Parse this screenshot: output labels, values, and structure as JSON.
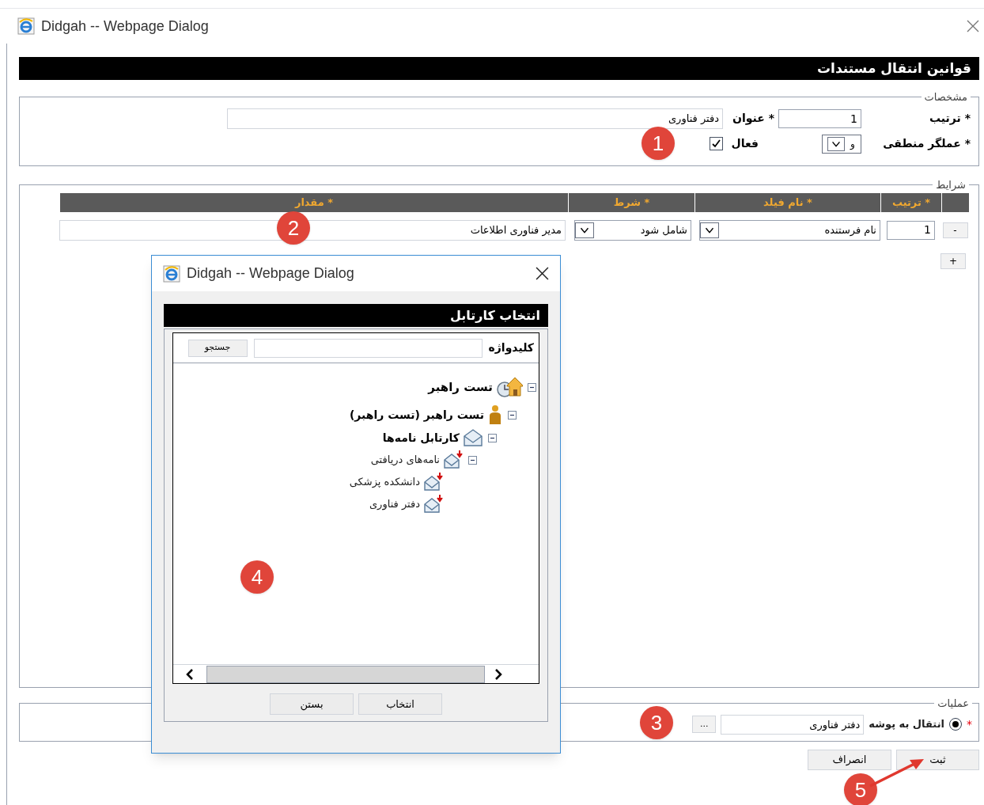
{
  "window": {
    "title": "Didgah -- Webpage Dialog"
  },
  "header": "قوانین انتقال مستندات",
  "details": {
    "legend": "مشخصات",
    "order_label": "* ترتیب",
    "order_value": "1",
    "title_label": "* عنوان",
    "title_value": "دفتر فناوری",
    "operator_label": "* عملگر منطقی",
    "operator_value": "و",
    "active_label": "فعال",
    "active_checked": true
  },
  "conditions": {
    "legend": "شرایط",
    "columns": [
      "* ترتیب",
      "* نام فیلد",
      "* شرط",
      "* مقدار"
    ],
    "rows": [
      {
        "remove": "-",
        "order": "1",
        "field": "نام فرستنده",
        "condition": "شامل شود",
        "value": "مدیر فناوری اطلاعات"
      }
    ],
    "add": "+"
  },
  "operations": {
    "legend": "عملیات",
    "required_mark": "*",
    "label": "انتقال به پوشه",
    "selected": true,
    "value": "دفتر فناوری",
    "browse": "..."
  },
  "buttons": [
    "ثبت",
    "انصراف"
  ],
  "picker": {
    "title": "Didgah -- Webpage Dialog",
    "header": "انتخاب کارتابل",
    "keyword_label": "کلیدواژه",
    "search_button": "جستجو",
    "tree": [
      {
        "label": "تست راهبر",
        "kind": "home",
        "expanded": true,
        "children": [
          {
            "label": "تست راهبر (تست راهبر)",
            "kind": "person",
            "expanded": true,
            "children": [
              {
                "label": "کارتابل نامه‌ها",
                "kind": "mailbox",
                "expanded": true,
                "children": [
                  {
                    "label": "نامه‌های دریافتی",
                    "kind": "inbox",
                    "expanded": true,
                    "children": [
                      {
                        "label": "دانشکده پزشکی",
                        "kind": "inbox"
                      },
                      {
                        "label": "دفتر فناوری",
                        "kind": "inbox"
                      }
                    ]
                  }
                ]
              }
            ]
          }
        ]
      }
    ],
    "buttons": [
      "انتخاب",
      "بستن"
    ]
  },
  "annotations": [
    "1",
    "2",
    "3",
    "4",
    "5"
  ]
}
